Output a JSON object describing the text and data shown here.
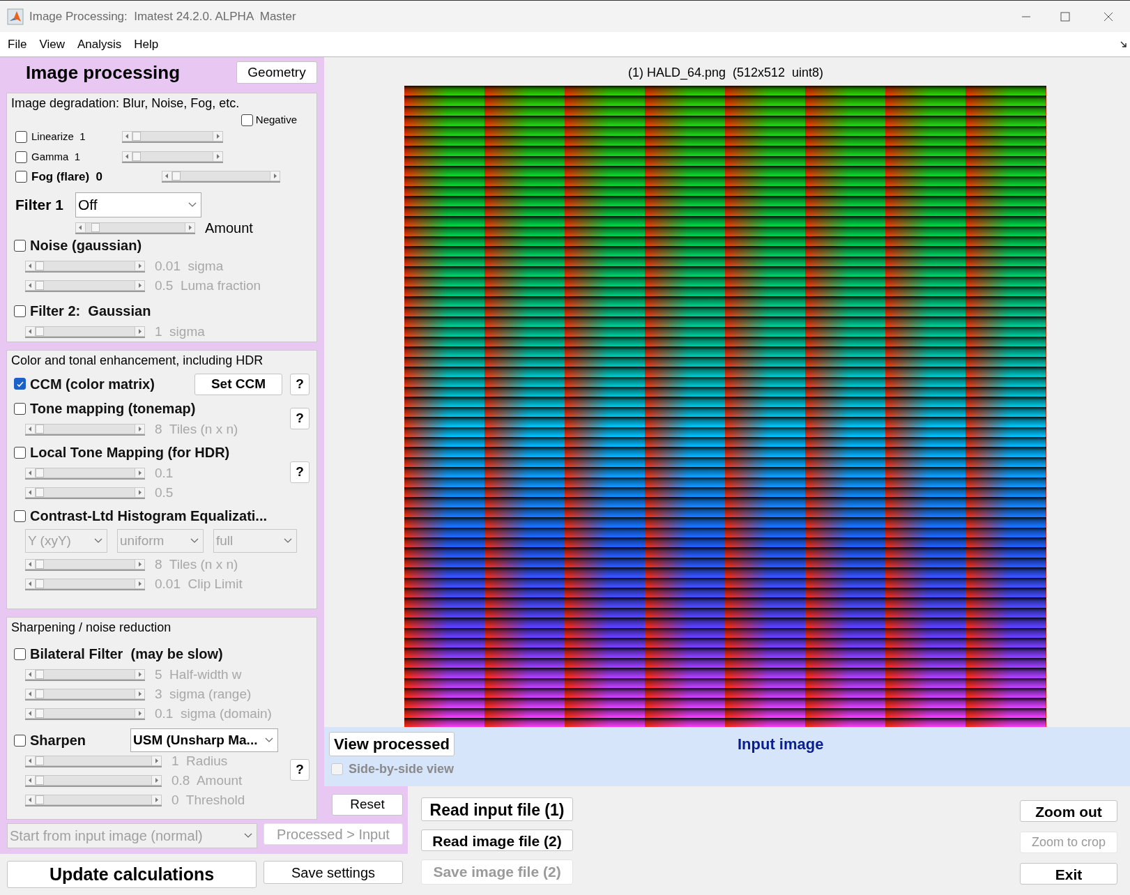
{
  "window": {
    "title": "Image Processing:  Imatest 24.2.0. ALPHA  Master"
  },
  "menu": [
    "File",
    "View",
    "Analysis",
    "Help"
  ],
  "panel": {
    "title": "Image processing",
    "geometry_button": "Geometry"
  },
  "degradation": {
    "title": "Image degradation: Blur, Noise, Fog, etc.",
    "negative": {
      "label": "Negative",
      "checked": false
    },
    "adjustments": [
      {
        "label": "Linearize",
        "value": "1",
        "checked": false,
        "bold": false,
        "level": 0
      },
      {
        "label": "Gamma",
        "value": "1",
        "checked": false,
        "bold": false,
        "level": 0
      },
      {
        "label": "Fog (flare)",
        "value": "0",
        "checked": false,
        "bold": true,
        "level": 0
      }
    ],
    "filter1": {
      "label": "Filter 1",
      "value": "Off",
      "level": 0.06,
      "amount_label": "Amount"
    },
    "groups": [
      {
        "label": "Noise (gaussian)",
        "checked": false,
        "sliders": [
          {
            "text": "0.01  sigma",
            "level": 0,
            "disabled": true
          },
          {
            "text": "0.5  Luma fraction",
            "level": 0,
            "disabled": true
          }
        ]
      },
      {
        "label": "Filter 2:  Gaussian",
        "checked": false,
        "sliders": [
          {
            "text": "1  sigma",
            "level": 0,
            "disabled": true
          }
        ]
      }
    ]
  },
  "enhancement": {
    "title": "Color and tonal enhancement, including HDR",
    "groups": [
      {
        "label": "CCM (color matrix)",
        "checked": true,
        "button": "Set CCM",
        "help": "?"
      },
      {
        "label": "Tone mapping (tonemap)",
        "checked": false,
        "help": "?",
        "sliders": [
          {
            "text": "8  Tiles (n x n)",
            "level": 0,
            "disabled": true
          }
        ]
      },
      {
        "label": "Local Tone Mapping (for HDR)",
        "checked": false,
        "help": "?",
        "sliders": [
          {
            "text": "0.1",
            "level": 0,
            "disabled": true
          },
          {
            "text": "0.5",
            "level": 0,
            "disabled": true
          }
        ]
      },
      {
        "label": "Contrast-Ltd Histogram Equalizati...",
        "checked": false,
        "dropdowns": [
          {
            "value": "Y (xyY)",
            "disabled": true
          },
          {
            "value": "uniform",
            "disabled": true
          },
          {
            "value": "full",
            "disabled": true
          }
        ],
        "sliders": [
          {
            "text": "8  Tiles (n x n)",
            "level": 0,
            "disabled": true
          },
          {
            "text": "0.01  Clip Limit",
            "level": 0,
            "disabled": true
          }
        ]
      }
    ]
  },
  "sharpening": {
    "title": "Sharpening / noise reduction",
    "groups": [
      {
        "label": "Bilateral Filter  (may be slow)",
        "checked": false,
        "sliders": [
          {
            "text": "5  Half-width w",
            "level": 0,
            "disabled": true
          },
          {
            "text": "3  sigma (range)",
            "level": 0,
            "disabled": true
          },
          {
            "text": "0.1  sigma (domain)",
            "level": 0,
            "disabled": true
          }
        ]
      },
      {
        "label": "Sharpen",
        "checked": false,
        "dropdown": {
          "value": "USM (Unsharp Ma...",
          "disabled": false
        },
        "help": "?",
        "sliders": [
          {
            "text": "1  Radius",
            "level": 0,
            "disabled": true
          },
          {
            "text": "0.8  Amount",
            "level": 0,
            "disabled": true
          },
          {
            "text": "0  Threshold",
            "level": 0,
            "disabled": true
          }
        ]
      }
    ]
  },
  "image_view": {
    "title": "(1) HALD_64.png  (512x512  uint8)"
  },
  "view_band": {
    "view_button": "View processed",
    "title": "Input image",
    "side_by_side": {
      "label": "Side-by-side view",
      "checked": false,
      "disabled": true
    }
  },
  "controls": {
    "reset": "Reset",
    "source": {
      "value": "Start from input image (normal)",
      "disabled": true
    },
    "processed_to_input": {
      "label": "Processed > Input",
      "disabled": true
    },
    "update": "Update calculations",
    "save_settings": "Save settings"
  },
  "file_buttons": [
    {
      "label": "Read input file (1)",
      "disabled": false
    },
    {
      "label": "Read image file (2)",
      "disabled": false
    },
    {
      "label": "Save image file (2)",
      "disabled": true
    }
  ],
  "view_buttons": [
    {
      "label": "Zoom out",
      "disabled": false
    },
    {
      "label": "Zoom to crop",
      "disabled": true
    },
    {
      "label": "Exit",
      "disabled": false
    }
  ]
}
